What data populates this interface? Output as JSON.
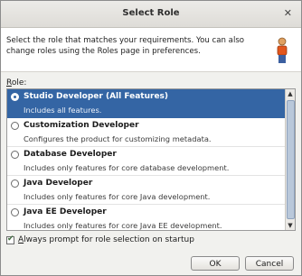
{
  "window": {
    "title": "Select Role",
    "close_glyph": "✕"
  },
  "banner": {
    "text": "Select the role that matches your requirements. You can also change roles using the Roles page in preferences.",
    "icon": "role-person-icon"
  },
  "role_label": {
    "underlined": "R",
    "rest": "ole:"
  },
  "roles": [
    {
      "title": "Studio Developer (All Features)",
      "description": "Includes all features.",
      "selected": true
    },
    {
      "title": "Customization Developer",
      "description": "Configures the product for customizing metadata.",
      "selected": false
    },
    {
      "title": "Database Developer",
      "description": "Includes only features for core database development.",
      "selected": false
    },
    {
      "title": "Java Developer",
      "description": "Includes only features for core Java development.",
      "selected": false
    },
    {
      "title": "Java EE Developer",
      "description": "Includes only features for core Java EE development.",
      "selected": false
    }
  ],
  "scrollbar": {
    "up_glyph": "▲",
    "down_glyph": "▼"
  },
  "always_prompt": {
    "underlined": "A",
    "rest": "lways prompt for role selection on startup",
    "checked": true,
    "check_glyph": "✔"
  },
  "buttons": {
    "ok": "OK",
    "cancel": "Cancel"
  },
  "colors": {
    "selection": "#3465a4",
    "dialog_bg": "#f1f1ee"
  }
}
